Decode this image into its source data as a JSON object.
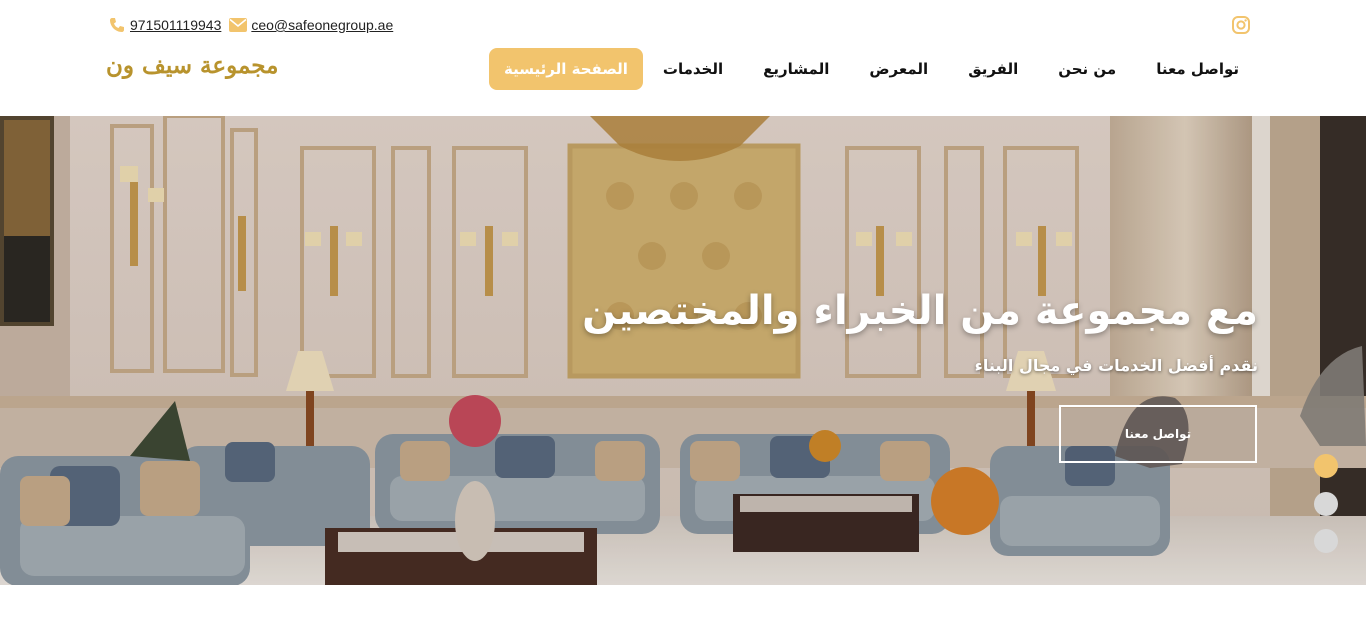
{
  "header": {
    "phone": "971501119943",
    "email": "ceo@safeonegroup.ae",
    "logo_text": "مجموعة سيف ون",
    "icons": {
      "phone": "phone-icon",
      "email": "envelope-icon",
      "instagram": "instagram-icon"
    },
    "accent_color": "#f2c46d",
    "contact_icon_color": "#f2c46d"
  },
  "nav": {
    "items": [
      {
        "label": "الصفحة الرئيسية",
        "active": true
      },
      {
        "label": "الخدمات",
        "active": false
      },
      {
        "label": "المشاريع",
        "active": false
      },
      {
        "label": "المعرض",
        "active": false
      },
      {
        "label": "الفريق",
        "active": false
      },
      {
        "label": "من نحن",
        "active": false
      },
      {
        "label": "تواصل معنا",
        "active": false
      }
    ]
  },
  "hero": {
    "title": "مع مجموعة من الخبراء والمختصين",
    "subtitle": "نقدم أفضل الخدمات في مجال البناء",
    "button_label": "تواصل معنا",
    "slider": {
      "count": 3,
      "active_index": 0,
      "active_color": "#f2c46d",
      "inactive_color": "#d8d8d8"
    }
  }
}
